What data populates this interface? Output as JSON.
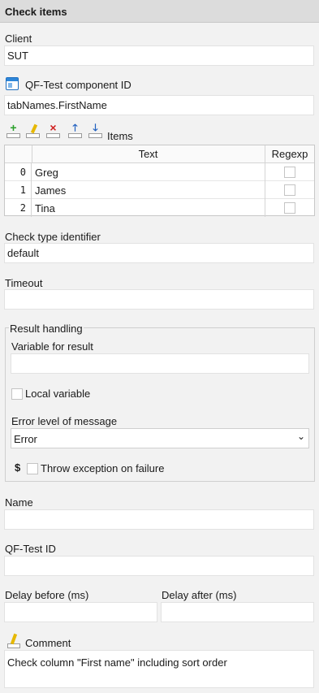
{
  "title": "Check items",
  "client": {
    "label": "Client",
    "value": "SUT"
  },
  "component": {
    "label": "QF-Test component ID",
    "value": "tabNames.FirstName"
  },
  "items": {
    "label": "Items",
    "toolbar": {
      "add": "+",
      "remove": "×",
      "up": "🡑",
      "down": "🡓"
    },
    "columns": {
      "text": "Text",
      "regexp": "Regexp"
    },
    "rows": [
      {
        "index": "0",
        "text": "Greg",
        "regexp": false
      },
      {
        "index": "1",
        "text": "James",
        "regexp": false
      },
      {
        "index": "2",
        "text": "Tina",
        "regexp": false
      }
    ]
  },
  "check_type": {
    "label": "Check type identifier",
    "value": "default"
  },
  "timeout": {
    "label": "Timeout",
    "value": ""
  },
  "result_handling": {
    "title": "Result handling",
    "variable_label": "Variable for result",
    "variable_value": "",
    "local_variable_label": "Local variable",
    "error_level_label": "Error level of message",
    "error_level_value": "Error",
    "dollar_symbol": "$",
    "throw_label": "Throw exception on failure"
  },
  "name": {
    "label": "Name",
    "value": ""
  },
  "qftest_id": {
    "label": "QF-Test ID",
    "value": ""
  },
  "delay_before": {
    "label": "Delay before (ms)",
    "value": ""
  },
  "delay_after": {
    "label": "Delay after (ms)",
    "value": ""
  },
  "comment": {
    "label": "Comment",
    "value": "Check column \"First name\" including sort order"
  },
  "colors": {
    "add_icon": "#2aa02a",
    "remove_icon": "#d02020",
    "arrow_icon": "#1f5fbf",
    "pen_icon": "#e6b800"
  }
}
